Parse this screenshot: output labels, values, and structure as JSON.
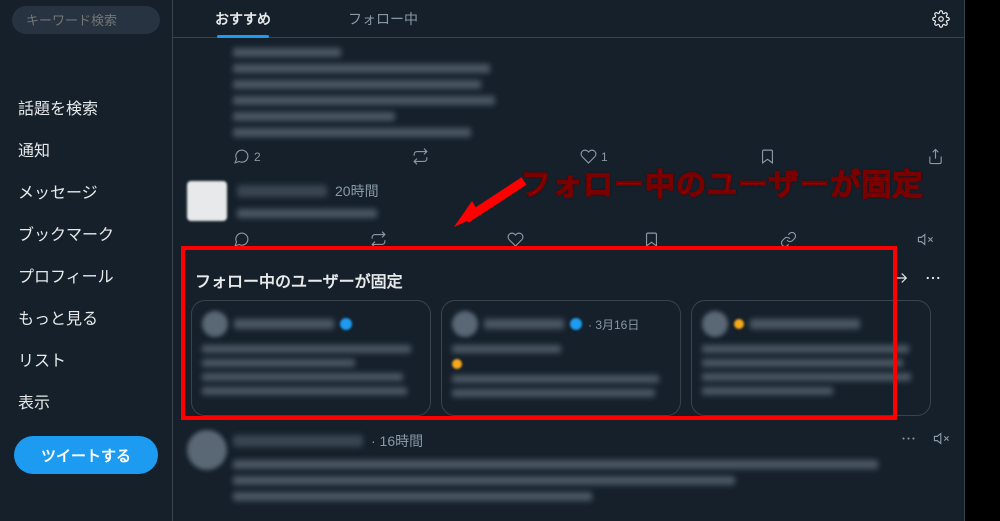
{
  "search_placeholder": "キーワード検索",
  "nav": {
    "items": [
      "話題を検索",
      "通知",
      "メッセージ",
      "ブックマーク",
      "プロフィール",
      "もっと見る",
      "リスト",
      "表示"
    ]
  },
  "tweet_button": "ツイートする",
  "tabs": {
    "recommend": "おすすめ",
    "following": "フォロー中"
  },
  "tweet1": {
    "reply_count": "2",
    "like_count": "1"
  },
  "tweet2": {
    "time": "20時間"
  },
  "pinned": {
    "title": "フォロー中のユーザーが固定",
    "cards": [
      {
        "date": ""
      },
      {
        "date": "· 3月16日"
      },
      {
        "date": ""
      }
    ]
  },
  "tweet3": {
    "time": "· 16時間"
  },
  "annotation": {
    "label": "フォロー中のユーザーが固定"
  }
}
